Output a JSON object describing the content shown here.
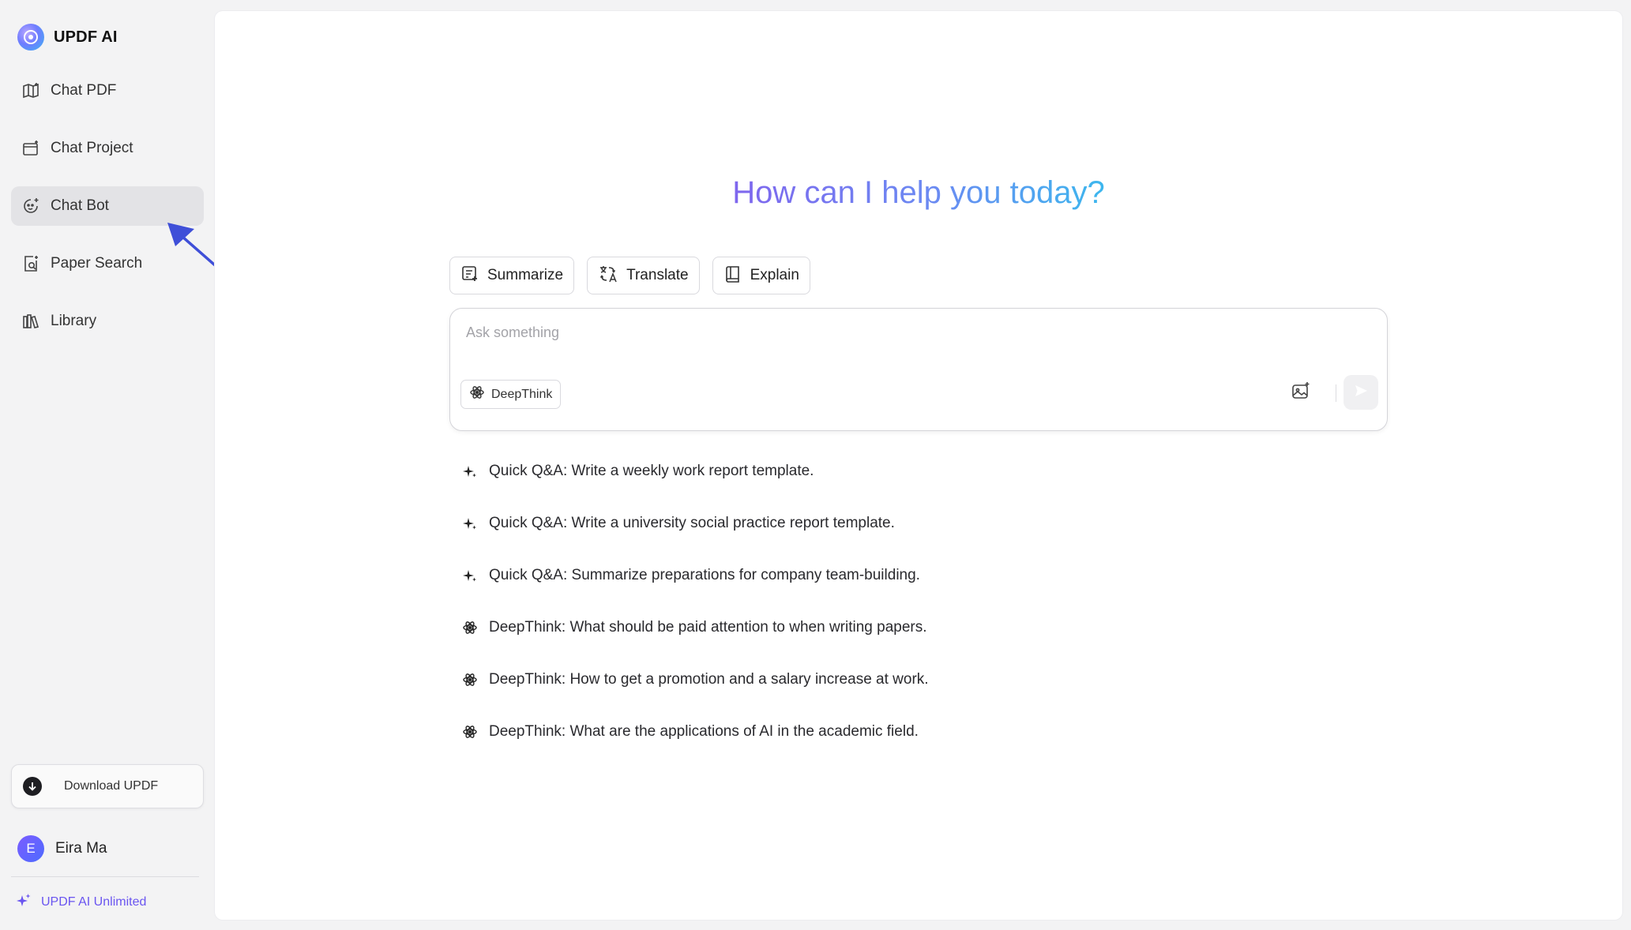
{
  "app": {
    "name": "UPDF AI"
  },
  "sidebar": {
    "items": [
      {
        "label": "Chat PDF",
        "icon": "chat-pdf-icon"
      },
      {
        "label": "Chat Project",
        "icon": "chat-project-icon"
      },
      {
        "label": "Chat Bot",
        "icon": "chat-bot-icon",
        "active": true
      },
      {
        "label": "Paper Search",
        "icon": "paper-search-icon"
      },
      {
        "label": "Library",
        "icon": "library-icon"
      }
    ],
    "download_label": "Download UPDF",
    "user": {
      "initial": "E",
      "name": "Eira Ma"
    },
    "plan_label": "UPDF AI Unlimited"
  },
  "main": {
    "headline": "How can I help you today?",
    "quick_actions": [
      {
        "label": "Summarize",
        "icon": "summarize-icon"
      },
      {
        "label": "Translate",
        "icon": "translate-icon"
      },
      {
        "label": "Explain",
        "icon": "explain-icon"
      }
    ],
    "input": {
      "placeholder": "Ask something",
      "value": "",
      "deepthink_label": "DeepThink"
    },
    "suggestions": [
      {
        "type": "quick",
        "text": "Quick Q&A: Write a weekly work report template."
      },
      {
        "type": "quick",
        "text": "Quick Q&A: Write a university social practice report template."
      },
      {
        "type": "quick",
        "text": "Quick Q&A: Summarize preparations for company team-building."
      },
      {
        "type": "deepthink",
        "text": "DeepThink: What should be paid attention to when writing papers."
      },
      {
        "type": "deepthink",
        "text": "DeepThink: How to get a promotion and a salary increase at work."
      },
      {
        "type": "deepthink",
        "text": "DeepThink: What are the applications of AI in the academic field."
      }
    ]
  },
  "colors": {
    "accent": "#6a55f0",
    "arrow": "#3f4fd8",
    "active_bg": "#e3e3e6"
  }
}
